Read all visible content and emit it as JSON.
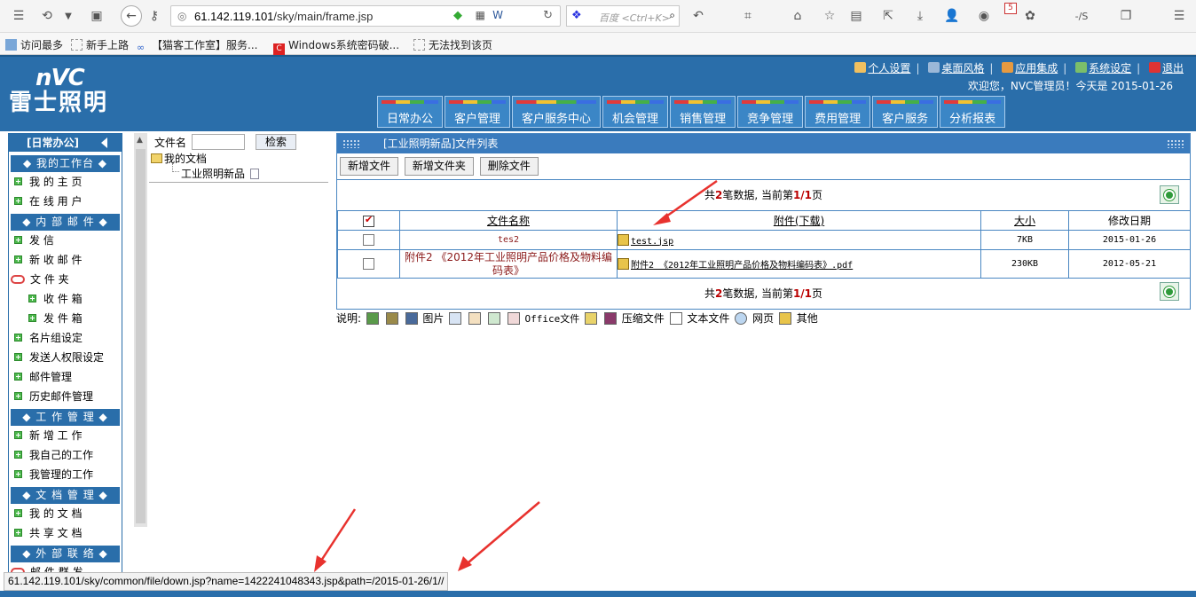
{
  "browser": {
    "url_host": "61.142.119.101",
    "url_path": "/sky/main/frame.jsp",
    "search_placeholder": "百度 <Ctrl+K>",
    "badge_count": "5",
    "bookmarks": [
      "访问最多",
      "新手上路",
      "【猫客工作室】服务...",
      "Windows系统密码破...",
      "无法找到该页"
    ]
  },
  "header": {
    "logo_top": "nVC",
    "logo_bottom": "雷士照明",
    "links": [
      "个人设置",
      "桌面风格",
      "应用集成",
      "系统设定",
      "退出"
    ],
    "welcome": "欢迎您，NVC管理员！今天是 2015-01-26",
    "tabs": [
      "日常办公",
      "客户管理",
      "客户服务中心",
      "机会管理",
      "销售管理",
      "竞争管理",
      "费用管理",
      "客户服务",
      "分析报表"
    ]
  },
  "sidebar": {
    "title": "[日常办公]",
    "s1": "◆ 我的工作台 ◆",
    "my_home": "我 的 主 页",
    "online_users": "在 线 用 户",
    "s2": "◆ 内 部 邮 件 ◆",
    "send": "发 信",
    "new_mail": "新 收 邮 件",
    "folder": "文 件 夹",
    "inbox": "收 件 箱",
    "outbox": "发 件 箱",
    "card_group": "名片组设定",
    "sender_perm": "发送人权限设定",
    "mail_mgmt": "邮件管理",
    "history_mail": "历史邮件管理",
    "s3": "◆ 工 作 管 理 ◆",
    "new_work": "新 增 工 作",
    "my_work": "我自己的工作",
    "managed_work": "我管理的工作",
    "s4": "◆ 文 档 管 理 ◆",
    "my_docs": "我 的 文 档",
    "shared_docs": "共 享 文 档",
    "s5": "◆ 外 部 联 络 ◆",
    "mass_mail": "邮 件 群 发"
  },
  "tree": {
    "label": "文件名",
    "search_btn": "检索",
    "root": "我的文档",
    "child": "工业照明新品"
  },
  "panel": {
    "title": "[工业照明新品]文件列表",
    "btn_new_file": "新增文件",
    "btn_new_folder": "新增文件夹",
    "btn_delete": "删除文件",
    "pager_pre": "共",
    "pager_count": "2",
    "pager_mid": "笔数据, 当前第",
    "pager_page": "1/1",
    "pager_post": "页",
    "columns": [
      "文件名称",
      "附件(下载)",
      "大小",
      "修改日期"
    ],
    "rows": [
      {
        "name": "tes2",
        "attachment": "test.jsp",
        "size": "7KB",
        "date": "2015-01-26"
      },
      {
        "name": "附件2 《2012年工业照明产品价格及物料编码表》",
        "attachment": "附件2 《2012年工业照明产品价格及物料编码表》.pdf",
        "size": "230KB",
        "date": "2012-05-21"
      }
    ]
  },
  "legend": {
    "label": "说明:",
    "image": "图片",
    "office": "Office文件",
    "zip": "压缩文件",
    "text": "文本文件",
    "web": "网页",
    "other": "其他"
  },
  "status": {
    "url": "61.142.119.101/sky/common/file/down.jsp?name=1422241048343.jsp&path=/2015-01-26/1//"
  },
  "colors": {
    "primary": "#2a6eaa",
    "panel_head": "#3a7bbd",
    "arrow": "#e8322e"
  }
}
